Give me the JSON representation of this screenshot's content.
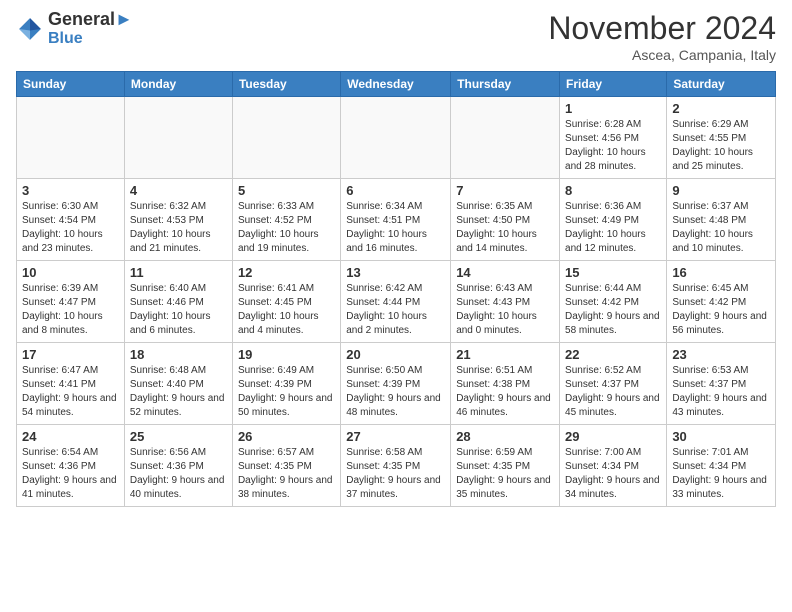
{
  "header": {
    "logo_line1": "General",
    "logo_line2": "Blue",
    "month_title": "November 2024",
    "location": "Ascea, Campania, Italy"
  },
  "weekdays": [
    "Sunday",
    "Monday",
    "Tuesday",
    "Wednesday",
    "Thursday",
    "Friday",
    "Saturday"
  ],
  "weeks": [
    [
      {
        "day": "",
        "info": ""
      },
      {
        "day": "",
        "info": ""
      },
      {
        "day": "",
        "info": ""
      },
      {
        "day": "",
        "info": ""
      },
      {
        "day": "",
        "info": ""
      },
      {
        "day": "1",
        "info": "Sunrise: 6:28 AM\nSunset: 4:56 PM\nDaylight: 10 hours and 28 minutes."
      },
      {
        "day": "2",
        "info": "Sunrise: 6:29 AM\nSunset: 4:55 PM\nDaylight: 10 hours and 25 minutes."
      }
    ],
    [
      {
        "day": "3",
        "info": "Sunrise: 6:30 AM\nSunset: 4:54 PM\nDaylight: 10 hours and 23 minutes."
      },
      {
        "day": "4",
        "info": "Sunrise: 6:32 AM\nSunset: 4:53 PM\nDaylight: 10 hours and 21 minutes."
      },
      {
        "day": "5",
        "info": "Sunrise: 6:33 AM\nSunset: 4:52 PM\nDaylight: 10 hours and 19 minutes."
      },
      {
        "day": "6",
        "info": "Sunrise: 6:34 AM\nSunset: 4:51 PM\nDaylight: 10 hours and 16 minutes."
      },
      {
        "day": "7",
        "info": "Sunrise: 6:35 AM\nSunset: 4:50 PM\nDaylight: 10 hours and 14 minutes."
      },
      {
        "day": "8",
        "info": "Sunrise: 6:36 AM\nSunset: 4:49 PM\nDaylight: 10 hours and 12 minutes."
      },
      {
        "day": "9",
        "info": "Sunrise: 6:37 AM\nSunset: 4:48 PM\nDaylight: 10 hours and 10 minutes."
      }
    ],
    [
      {
        "day": "10",
        "info": "Sunrise: 6:39 AM\nSunset: 4:47 PM\nDaylight: 10 hours and 8 minutes."
      },
      {
        "day": "11",
        "info": "Sunrise: 6:40 AM\nSunset: 4:46 PM\nDaylight: 10 hours and 6 minutes."
      },
      {
        "day": "12",
        "info": "Sunrise: 6:41 AM\nSunset: 4:45 PM\nDaylight: 10 hours and 4 minutes."
      },
      {
        "day": "13",
        "info": "Sunrise: 6:42 AM\nSunset: 4:44 PM\nDaylight: 10 hours and 2 minutes."
      },
      {
        "day": "14",
        "info": "Sunrise: 6:43 AM\nSunset: 4:43 PM\nDaylight: 10 hours and 0 minutes."
      },
      {
        "day": "15",
        "info": "Sunrise: 6:44 AM\nSunset: 4:42 PM\nDaylight: 9 hours and 58 minutes."
      },
      {
        "day": "16",
        "info": "Sunrise: 6:45 AM\nSunset: 4:42 PM\nDaylight: 9 hours and 56 minutes."
      }
    ],
    [
      {
        "day": "17",
        "info": "Sunrise: 6:47 AM\nSunset: 4:41 PM\nDaylight: 9 hours and 54 minutes."
      },
      {
        "day": "18",
        "info": "Sunrise: 6:48 AM\nSunset: 4:40 PM\nDaylight: 9 hours and 52 minutes."
      },
      {
        "day": "19",
        "info": "Sunrise: 6:49 AM\nSunset: 4:39 PM\nDaylight: 9 hours and 50 minutes."
      },
      {
        "day": "20",
        "info": "Sunrise: 6:50 AM\nSunset: 4:39 PM\nDaylight: 9 hours and 48 minutes."
      },
      {
        "day": "21",
        "info": "Sunrise: 6:51 AM\nSunset: 4:38 PM\nDaylight: 9 hours and 46 minutes."
      },
      {
        "day": "22",
        "info": "Sunrise: 6:52 AM\nSunset: 4:37 PM\nDaylight: 9 hours and 45 minutes."
      },
      {
        "day": "23",
        "info": "Sunrise: 6:53 AM\nSunset: 4:37 PM\nDaylight: 9 hours and 43 minutes."
      }
    ],
    [
      {
        "day": "24",
        "info": "Sunrise: 6:54 AM\nSunset: 4:36 PM\nDaylight: 9 hours and 41 minutes."
      },
      {
        "day": "25",
        "info": "Sunrise: 6:56 AM\nSunset: 4:36 PM\nDaylight: 9 hours and 40 minutes."
      },
      {
        "day": "26",
        "info": "Sunrise: 6:57 AM\nSunset: 4:35 PM\nDaylight: 9 hours and 38 minutes."
      },
      {
        "day": "27",
        "info": "Sunrise: 6:58 AM\nSunset: 4:35 PM\nDaylight: 9 hours and 37 minutes."
      },
      {
        "day": "28",
        "info": "Sunrise: 6:59 AM\nSunset: 4:35 PM\nDaylight: 9 hours and 35 minutes."
      },
      {
        "day": "29",
        "info": "Sunrise: 7:00 AM\nSunset: 4:34 PM\nDaylight: 9 hours and 34 minutes."
      },
      {
        "day": "30",
        "info": "Sunrise: 7:01 AM\nSunset: 4:34 PM\nDaylight: 9 hours and 33 minutes."
      }
    ]
  ]
}
